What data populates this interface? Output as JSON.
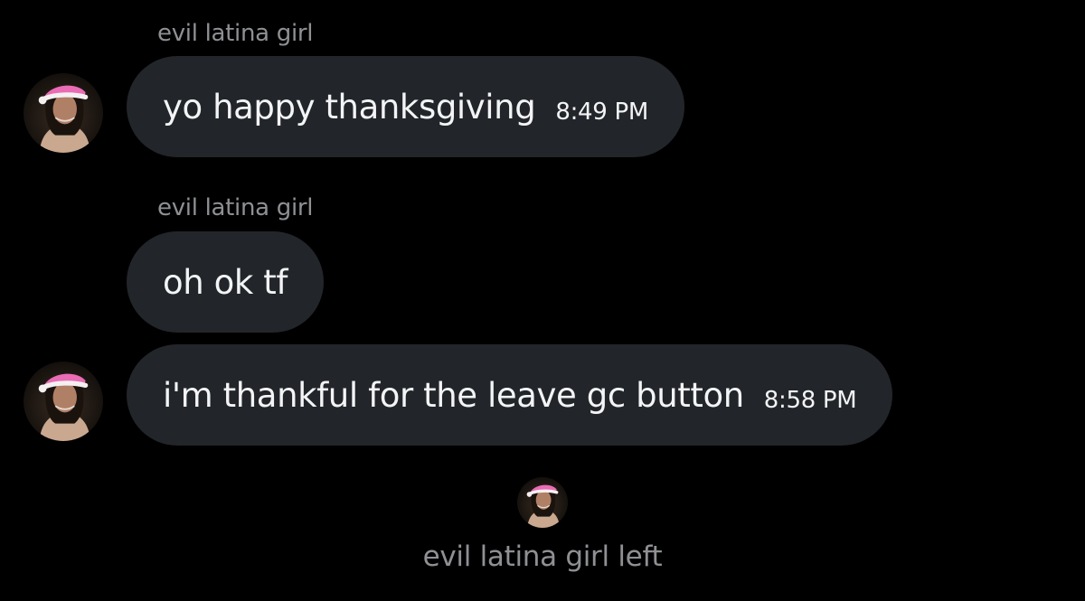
{
  "conversation": {
    "messages": [
      {
        "sender": "evil latina girl",
        "text": "yo happy thanksgiving",
        "time": "8:49 PM"
      },
      {
        "sender": "evil latina girl",
        "text": "oh ok tf",
        "time": ""
      },
      {
        "sender": "",
        "text": "i'm thankful for the leave gc button",
        "time": "8:58 PM"
      }
    ],
    "system_notice": "evil latina girl left"
  },
  "colors": {
    "background": "#000000",
    "bubble": "#22252a",
    "muted_text": "#8e9094",
    "message_text": "#f3f4f5"
  }
}
